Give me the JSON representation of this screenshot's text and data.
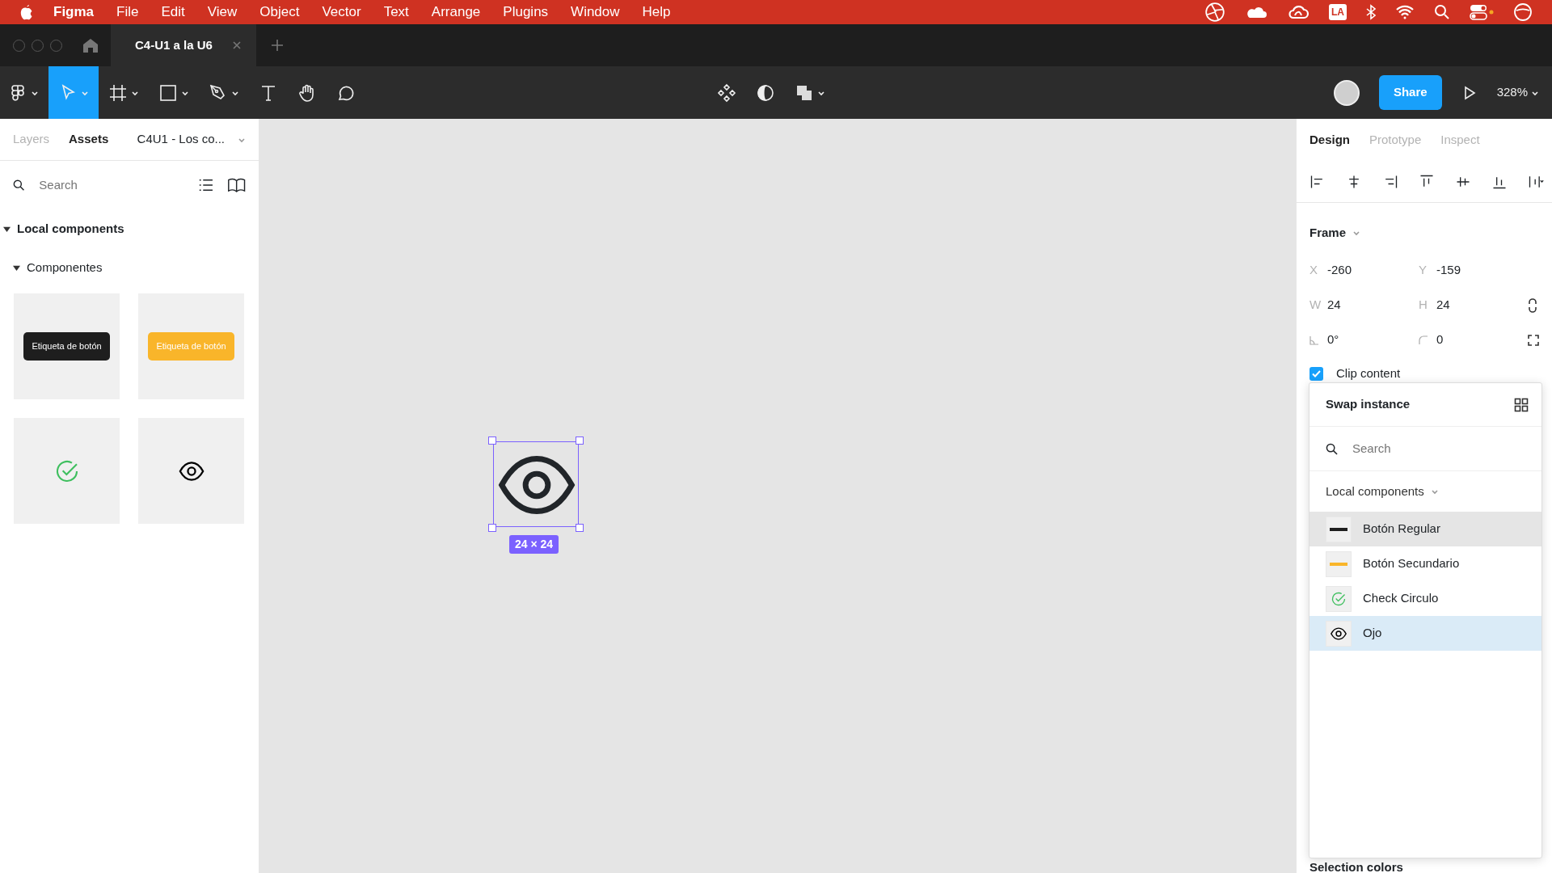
{
  "menu_bar": {
    "app": "Figma",
    "items": [
      "File",
      "Edit",
      "View",
      "Object",
      "Vector",
      "Text",
      "Arrange",
      "Plugins",
      "Window",
      "Help"
    ],
    "status_badge": "LA"
  },
  "tab_bar": {
    "tabs": [
      {
        "label": "C4-U1 a la U6",
        "selected": true
      }
    ]
  },
  "toolbar": {
    "tools": [
      {
        "kind": "main-menu",
        "selected": false
      },
      {
        "kind": "move",
        "selected": true
      },
      {
        "kind": "frame",
        "selected": false
      },
      {
        "kind": "shape",
        "selected": false
      },
      {
        "kind": "pen",
        "selected": false
      },
      {
        "kind": "text",
        "selected": false
      },
      {
        "kind": "hand",
        "selected": false
      },
      {
        "kind": "comment",
        "selected": false
      }
    ],
    "share": "Share",
    "zoom": "328%"
  },
  "left_panel": {
    "tabs": [
      {
        "label": "Layers",
        "selected": false
      },
      {
        "label": "Assets",
        "selected": true
      }
    ],
    "library": "C4U1 - Los co...",
    "search": {
      "placeholder": "Search"
    },
    "section": {
      "title": "Local components",
      "expanded": true
    },
    "group": {
      "title": "Componentes",
      "expanded": true
    },
    "assets": [
      {
        "kind": "button",
        "label": "Etiqueta de botón",
        "color": "#1e1e1e"
      },
      {
        "kind": "button",
        "label": "Etiqueta de botón",
        "color": "#f9b52a"
      },
      {
        "kind": "check"
      },
      {
        "kind": "eye"
      }
    ]
  },
  "canvas": {
    "selection_size": "24 × 24"
  },
  "right_panel": {
    "tabs": [
      {
        "label": "Design",
        "selected": true
      },
      {
        "label": "Prototype",
        "selected": false
      },
      {
        "label": "Inspect",
        "selected": false
      }
    ],
    "frame_title": "Frame",
    "fields": [
      {
        "kind": "label",
        "label": "X",
        "value": "-260"
      },
      {
        "kind": "label",
        "label": "Y",
        "value": "-159"
      },
      {
        "kind": "label",
        "label": "W",
        "value": "24"
      },
      {
        "kind": "label",
        "label": "H",
        "value": "24"
      },
      {
        "kind": "rotation",
        "value": "0°"
      },
      {
        "kind": "radius",
        "value": "0"
      }
    ],
    "clip_content": {
      "label": "Clip content",
      "checked": true
    },
    "selection_colors_title": "Selection colors"
  },
  "swap_popup": {
    "title": "Swap instance",
    "search": {
      "placeholder": "Search"
    },
    "library": "Local components",
    "items": [
      {
        "kind": "dark-bar",
        "label": "Botón Regular",
        "hovered": true,
        "selected": false
      },
      {
        "kind": "yellow-bar",
        "label": "Botón Secundario",
        "hovered": false,
        "selected": false
      },
      {
        "kind": "check",
        "label": "Check Circulo",
        "hovered": false,
        "selected": false
      },
      {
        "kind": "eye",
        "label": "Ojo",
        "hovered": false,
        "selected": true
      }
    ]
  }
}
